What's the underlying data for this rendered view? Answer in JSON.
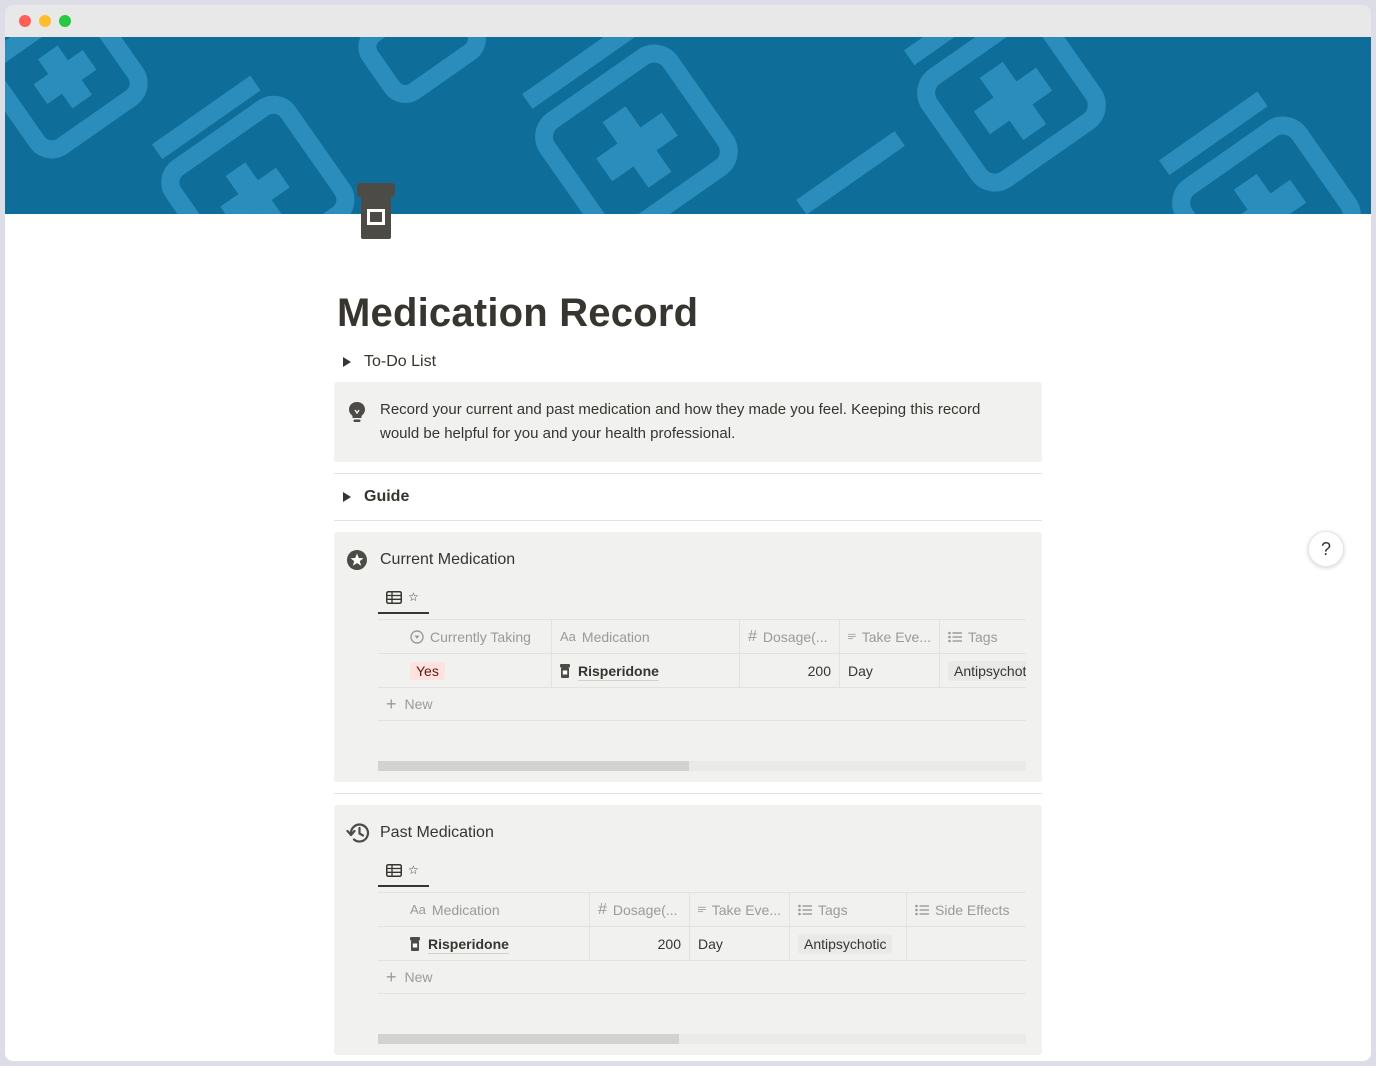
{
  "window": {
    "controls": [
      "close",
      "minimize",
      "maximize"
    ]
  },
  "cover": {
    "background": "#0e6e99",
    "pattern": "medical-cross-icons"
  },
  "page": {
    "icon": "pill-bottle-icon",
    "title": "Medication Record",
    "todo_toggle": "To-Do List",
    "callout": {
      "icon": "lightbulb-icon",
      "text": "Record your current and past medication and how they made you feel. Keeping this record would be helpful for you and your health professional."
    },
    "guide_toggle": "Guide"
  },
  "current": {
    "icon": "star-circle-icon",
    "title": "Current Medication",
    "view_tab": "☆",
    "columns": [
      {
        "icon": "status-icon",
        "label": "Currently Taking"
      },
      {
        "icon": "title-icon",
        "label": "Medication"
      },
      {
        "icon": "number-icon",
        "label": "Dosage(..."
      },
      {
        "icon": "text-icon",
        "label": "Take Eve..."
      },
      {
        "icon": "list-icon",
        "label": "Tags"
      }
    ],
    "rows": [
      {
        "currently_taking": "Yes",
        "medication": "Risperidone",
        "dosage": "200",
        "take_every": "Day",
        "tags": "Antipsychotic"
      }
    ],
    "new_label": "New",
    "scroll_fraction": 0.48
  },
  "past": {
    "icon": "history-icon",
    "title": "Past Medication",
    "view_tab": "☆",
    "columns": [
      {
        "icon": "title-icon",
        "label": "Medication"
      },
      {
        "icon": "number-icon",
        "label": "Dosage(..."
      },
      {
        "icon": "text-icon",
        "label": "Take Eve..."
      },
      {
        "icon": "list-icon",
        "label": "Tags"
      },
      {
        "icon": "list-icon",
        "label": "Side Effects"
      }
    ],
    "rows": [
      {
        "medication": "Risperidone",
        "dosage": "200",
        "take_every": "Day",
        "tags": "Antipsychotic",
        "side_effects": ""
      }
    ],
    "new_label": "New",
    "scroll_fraction": 0.465
  },
  "help_button": "?",
  "colors": {
    "text": "#37352f",
    "muted": "#9b9a97",
    "block_bg": "#f1f1ef",
    "yes_pill_bg": "#ffe2dd"
  }
}
